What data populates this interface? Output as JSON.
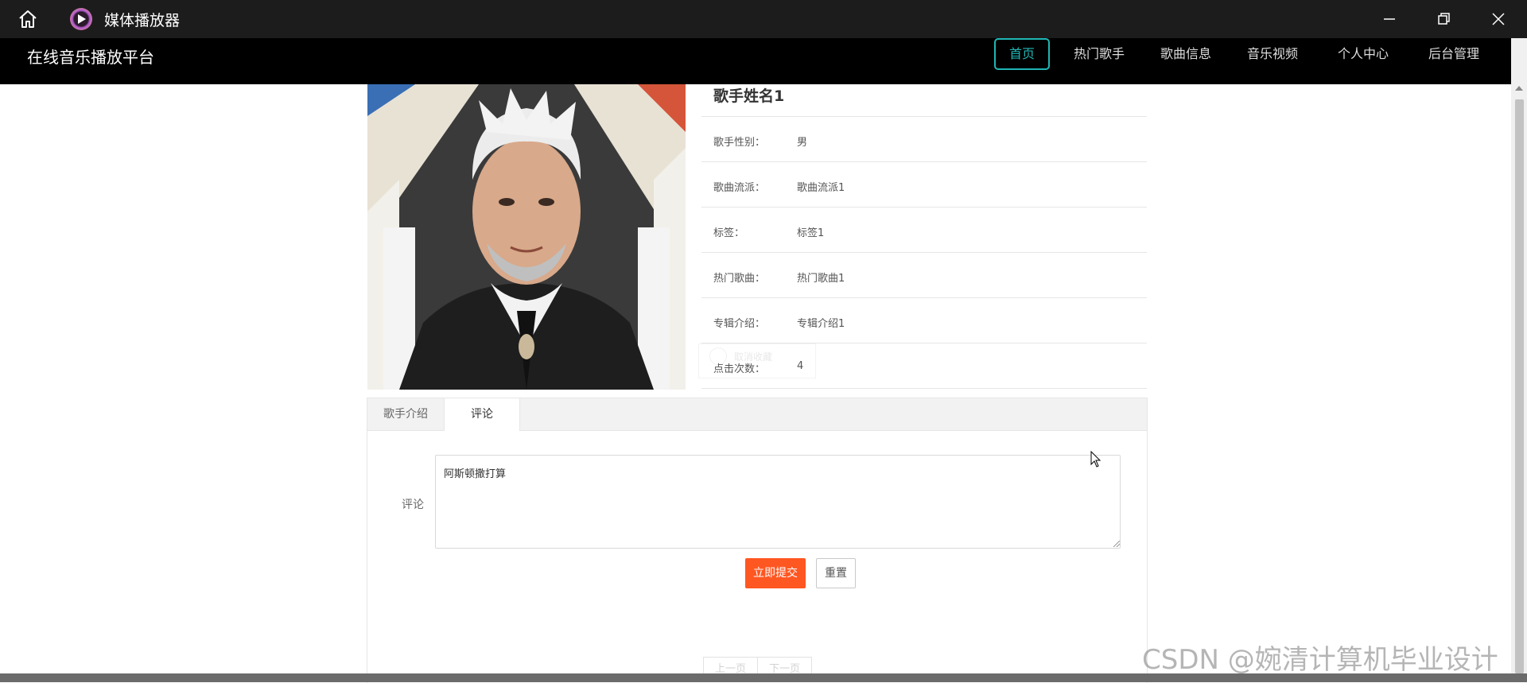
{
  "window": {
    "title": "媒体播放器"
  },
  "nav": {
    "brand": "在线音乐播放平台",
    "items": [
      "首页",
      "热门歌手",
      "歌曲信息",
      "音乐视频",
      "个人中心",
      "后台管理"
    ]
  },
  "singer": {
    "name": "歌手姓名1",
    "fields": [
      {
        "label": "歌手性别：",
        "value": "男"
      },
      {
        "label": "歌曲流派：",
        "value": "歌曲流派1"
      },
      {
        "label": "标签：",
        "value": "标签1"
      },
      {
        "label": "热门歌曲：",
        "value": "热门歌曲1"
      },
      {
        "label": "专辑介绍：",
        "value": "专辑介绍1"
      },
      {
        "label": "点击次数：",
        "value": "4"
      }
    ],
    "ghost_label": "取消收藏"
  },
  "tabs": {
    "intro": "歌手介绍",
    "comment": "评论"
  },
  "comment_form": {
    "label": "评论",
    "value": "阿斯顿撒打算",
    "submit": "立即提交",
    "reset": "重置"
  },
  "pager": {
    "prev": "上一页",
    "next": "下一页"
  },
  "watermark": "CSDN @婉清计算机毕业设计",
  "colors": {
    "accent": "#1fb6b4",
    "submit": "#ff5722",
    "nav_bg": "#000000"
  }
}
